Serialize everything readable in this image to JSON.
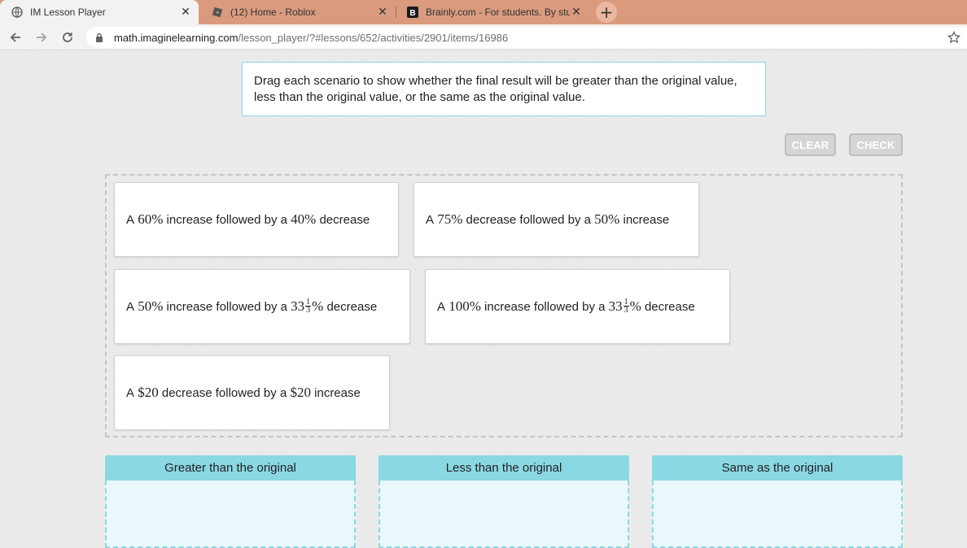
{
  "browser": {
    "tabs": [
      {
        "title": "IM Lesson Player",
        "icon": "globe-icon",
        "active": true
      },
      {
        "title": "(12) Home - Roblox",
        "icon": "roblox-icon",
        "active": false
      },
      {
        "title": "Brainly.com - For students. By stu",
        "icon": "brainly-icon",
        "active": false
      }
    ],
    "new_tab_label": "+",
    "close_glyph": "✕",
    "url_host": "math.imaginelearning.com",
    "url_path": "/lesson_player/?#lessons/652/activities/2901/items/16986"
  },
  "prompt": "Drag each scenario to show whether the final result will be greater than the original value, less than the original value, or the same as the original value.",
  "buttons": {
    "clear": "CLEAR",
    "check": "CHECK"
  },
  "cards": [
    {
      "pre": "A",
      "v1": "60%",
      "mid": "increase followed by a",
      "v2": "40%",
      "post": "decrease"
    },
    {
      "pre": "A",
      "v1": "75%",
      "mid": "decrease followed by a",
      "v2": "50%",
      "post": "increase"
    },
    {
      "pre": "A",
      "v1": "50%",
      "mid": "increase followed by a",
      "v2_whole": "33",
      "v2_num": "1",
      "v2_den": "3",
      "v2_pct": "%",
      "post": "decrease"
    },
    {
      "pre": "A",
      "v1": "100%",
      "mid": "increase followed by a",
      "v2_whole": "33",
      "v2_num": "1",
      "v2_den": "3",
      "v2_pct": "%",
      "post": "decrease"
    },
    {
      "pre": "A",
      "v1": "$20",
      "mid": "decrease followed by a",
      "v2": "$20",
      "post": "increase"
    }
  ],
  "bins": [
    {
      "label": "Greater than the original"
    },
    {
      "label": "Less than the original"
    },
    {
      "label": "Same as the original"
    }
  ],
  "colors": {
    "tabbar": "#d99a7e",
    "bin_header": "#8ad8e4",
    "prompt_border": "#8fd6e2"
  }
}
